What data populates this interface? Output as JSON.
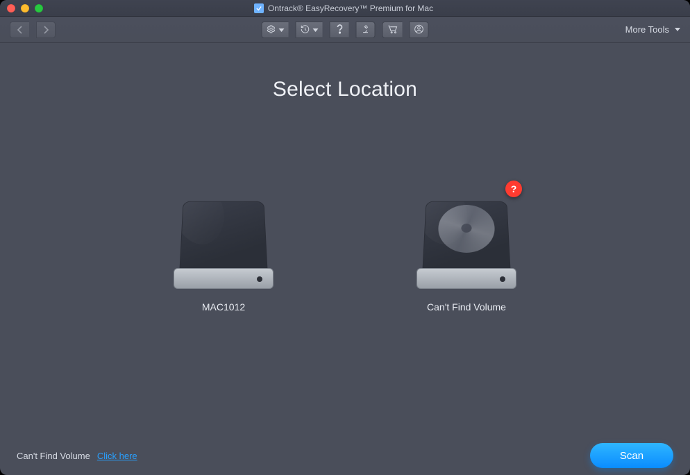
{
  "title": "Ontrack® EasyRecovery™ Premium for Mac",
  "toolbar": {
    "more_tools": "More Tools"
  },
  "main": {
    "heading": "Select Location",
    "drives": [
      {
        "label": "MAC1012",
        "showDisc": false,
        "badge": null
      },
      {
        "label": "Can't Find Volume",
        "showDisc": true,
        "badge": "?"
      }
    ]
  },
  "footer": {
    "hint_text": "Can't Find Volume",
    "link_text": "Click here",
    "scan_label": "Scan"
  },
  "colors": {
    "accent": "#0a8cff",
    "badge": "#ff3b30"
  }
}
